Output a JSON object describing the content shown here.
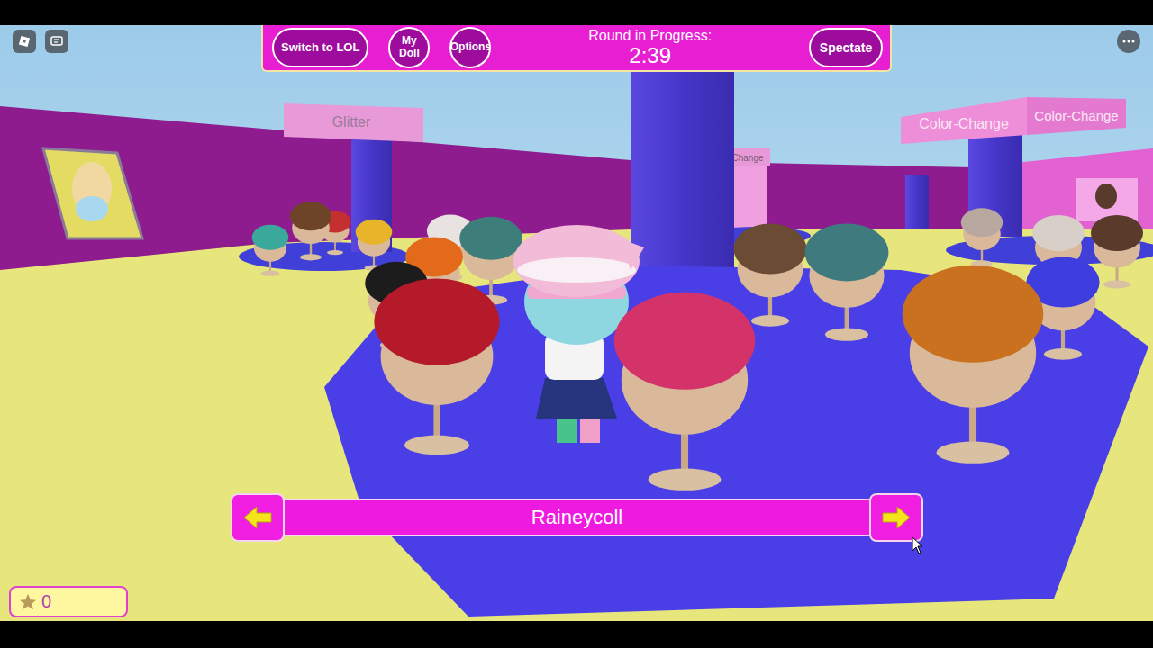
{
  "hud": {
    "buttons": [
      {
        "label": "Switch to LOL"
      },
      {
        "label": "My Doll"
      },
      {
        "label": "Options"
      }
    ],
    "round": {
      "label": "Round in Progress:",
      "time": "2:39"
    },
    "spectate": {
      "label": "Spectate"
    }
  },
  "selector": {
    "name": "Raineycoll"
  },
  "stars": {
    "count": "0"
  },
  "signs": [
    {
      "label": "Glitter"
    },
    {
      "label": "Color-Change"
    },
    {
      "label": "Color-Change"
    },
    {
      "label": "Change"
    }
  ],
  "wigs": [
    {
      "color": "#3aa89a"
    },
    {
      "color": "#c43030"
    },
    {
      "color": "#6e4428"
    },
    {
      "color": "#e8b42a"
    },
    {
      "color": "#e8e2e0"
    },
    {
      "color": "#3d7d7a"
    },
    {
      "color": "#e26a1a"
    },
    {
      "color": "#1c1c1c"
    },
    {
      "color": "#b8a8a0"
    },
    {
      "color": "#d8d0c8"
    },
    {
      "color": "#5a3a2a"
    },
    {
      "color": "#6b4b33"
    },
    {
      "color": "#3f7b7e"
    },
    {
      "color": "#3d3de0"
    },
    {
      "color": "#b51a2a"
    },
    {
      "color": "#c9711f"
    },
    {
      "color": "#d4336a"
    }
  ]
}
